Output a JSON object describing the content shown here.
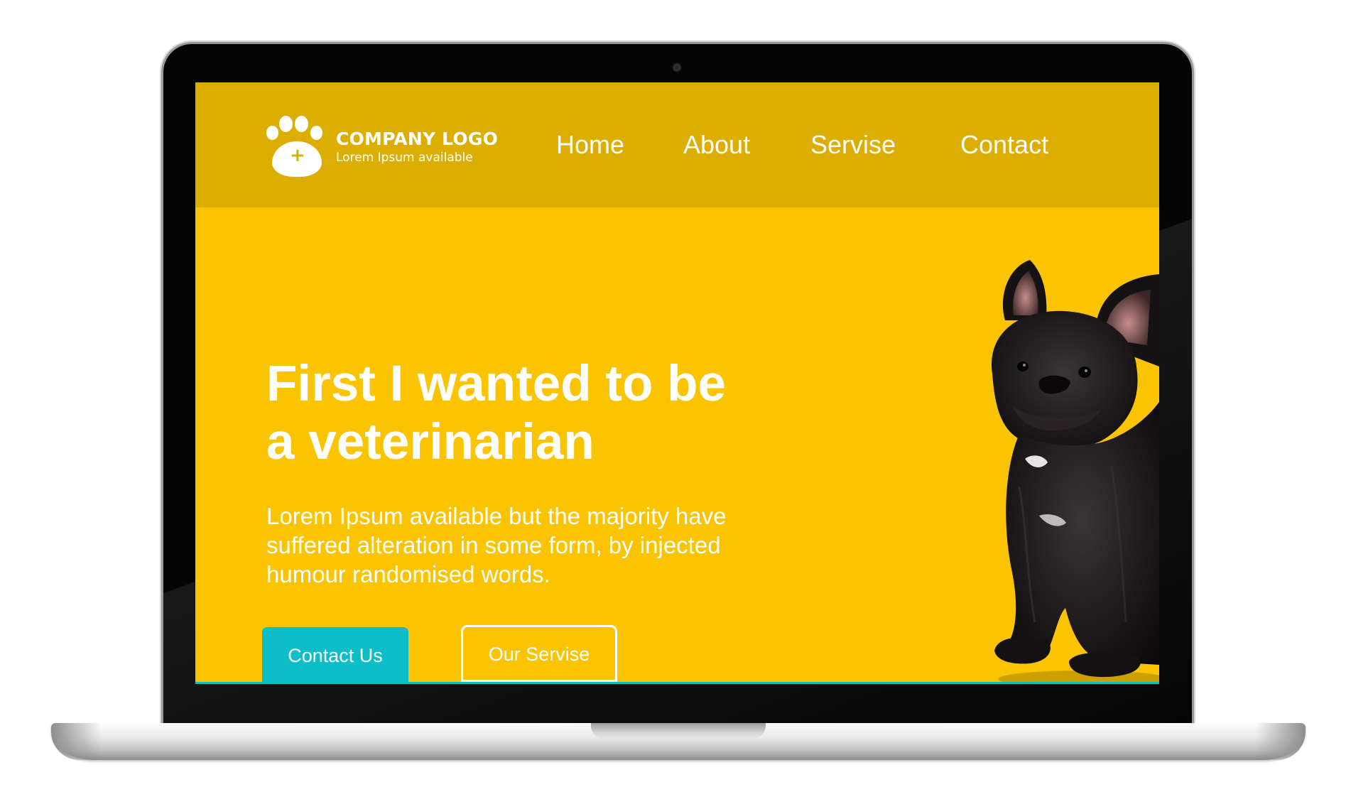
{
  "logo": {
    "title": "COMPANY LOGO",
    "subtitle": "Lorem Ipsum available",
    "icon": "paw-plus-icon"
  },
  "nav": {
    "items": [
      {
        "label": "Home"
      },
      {
        "label": "About"
      },
      {
        "label": "Servise"
      },
      {
        "label": "Contact"
      }
    ]
  },
  "hero": {
    "title_line1": "First I wanted to be",
    "title_line2": "a veterinarian",
    "desc_line1": "Lorem Ipsum available but the majority have",
    "desc_line2": "suffered alteration in some form, by injected",
    "desc_line3": "humour randomised words.",
    "image": "french-bulldog-photo"
  },
  "buttons": {
    "contact_label": "Contact Us",
    "service_label": "Our Servise"
  },
  "colors": {
    "header_bg": "#dcae02",
    "page_bg": "#fac402",
    "accent": "#0dbec9",
    "text": "#ffffff"
  }
}
